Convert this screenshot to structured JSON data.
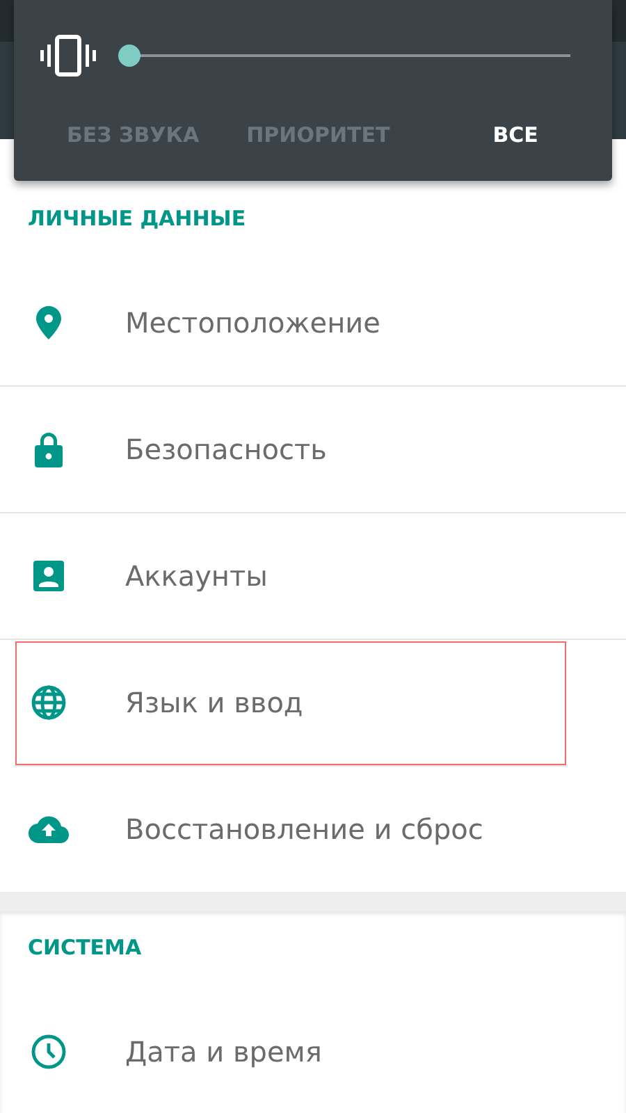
{
  "volume_panel": {
    "level": 0,
    "modes": [
      {
        "label": "БЕЗ ЗВУКА",
        "selected": false
      },
      {
        "label": "ПРИОРИТЕТ",
        "selected": false
      },
      {
        "label": "ВСЕ",
        "selected": true
      }
    ]
  },
  "sections": [
    {
      "title": "ЛИЧНЫЕ ДАННЫЕ",
      "items": [
        {
          "label": "Местоположение",
          "highlighted": false
        },
        {
          "label": "Безопасность",
          "highlighted": false
        },
        {
          "label": "Аккаунты",
          "highlighted": false
        },
        {
          "label": "Язык и ввод",
          "highlighted": true
        },
        {
          "label": "Восстановление и сброс",
          "highlighted": false
        }
      ]
    },
    {
      "title": "СИСТЕМА",
      "items": [
        {
          "label": "Дата и время",
          "highlighted": false
        }
      ]
    }
  ]
}
